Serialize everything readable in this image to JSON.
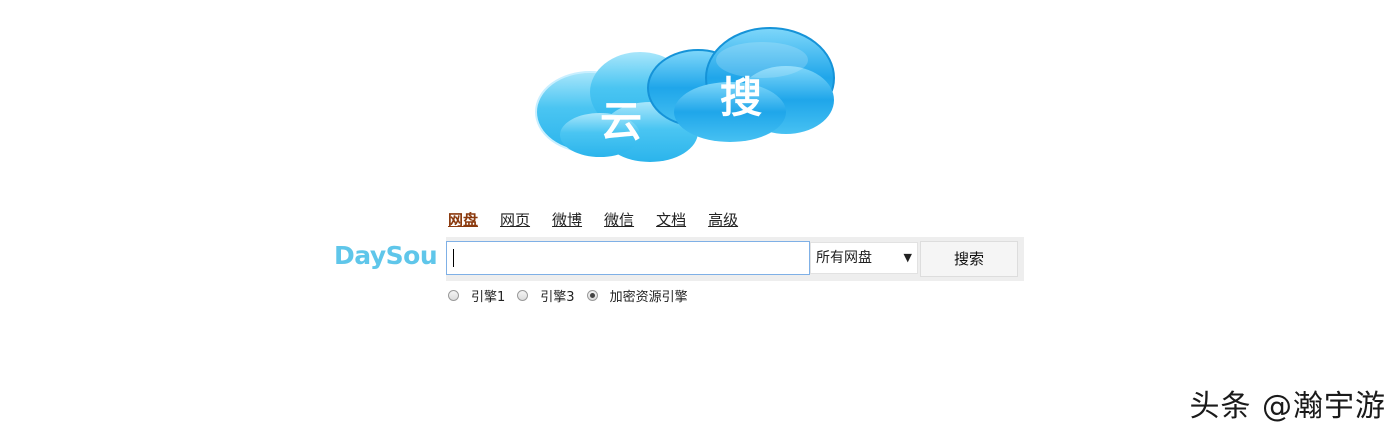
{
  "logo": {
    "char_left": "云",
    "char_right": "搜"
  },
  "nav": {
    "tabs": [
      {
        "label": "网盘",
        "active": true
      },
      {
        "label": "网页",
        "active": false
      },
      {
        "label": "微博",
        "active": false
      },
      {
        "label": "微信",
        "active": false
      },
      {
        "label": "文档",
        "active": false
      },
      {
        "label": "高级",
        "active": false
      }
    ]
  },
  "brand": {
    "text": "DaySou",
    "color": "#5fc6ea"
  },
  "search": {
    "value": "",
    "select_value": "所有网盘",
    "select_arrow": "▼",
    "button_label": "搜索"
  },
  "radios": [
    {
      "label": "引擎1",
      "checked": false
    },
    {
      "label": "引擎3",
      "checked": false
    },
    {
      "label": "加密资源引擎",
      "checked": true
    }
  ],
  "watermark": {
    "text": "头条 @瀚宇游"
  },
  "colors": {
    "active_tab": "#8b3a0e",
    "cloud_light": "#4cc8f4",
    "cloud_dark": "#1aa3e6"
  }
}
